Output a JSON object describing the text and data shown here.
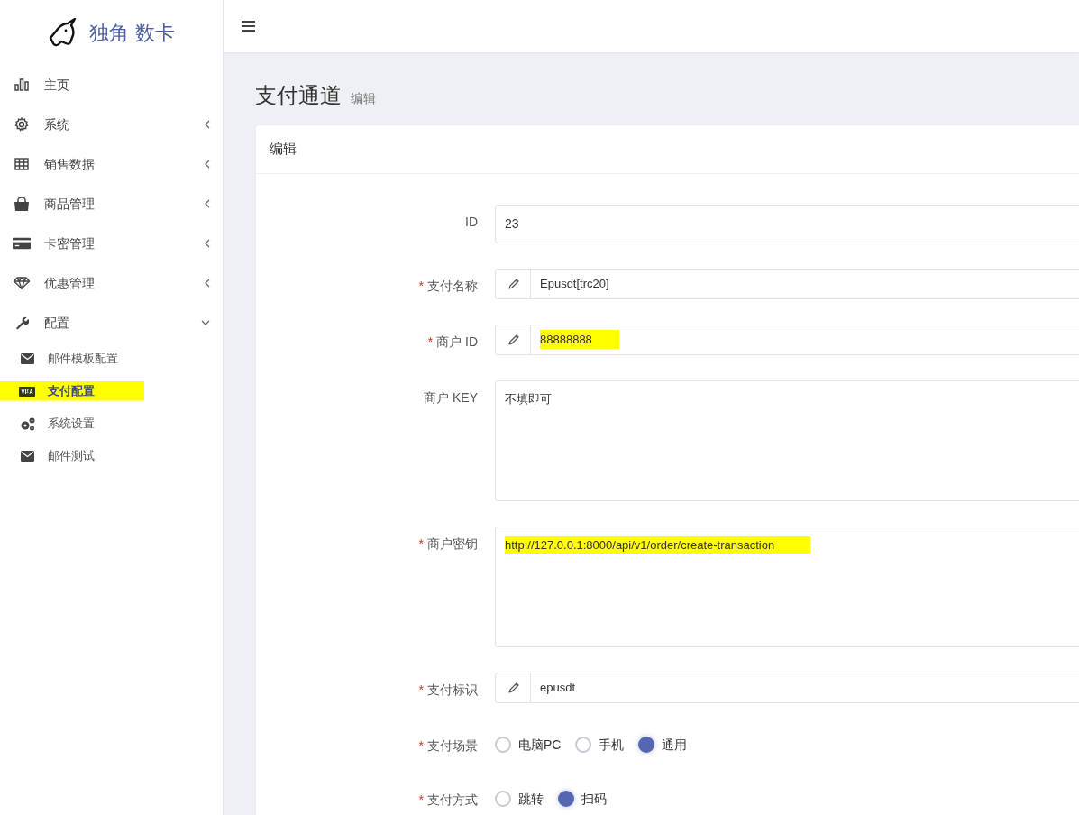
{
  "brand": {
    "name": "独角 数卡"
  },
  "sidebar": {
    "items": [
      {
        "label": "主页"
      },
      {
        "label": "系统",
        "expanded": false
      },
      {
        "label": "销售数据",
        "expanded": false
      },
      {
        "label": "商品管理",
        "expanded": false
      },
      {
        "label": "卡密管理",
        "expanded": false
      },
      {
        "label": "优惠管理",
        "expanded": false
      },
      {
        "label": "配置",
        "expanded": true,
        "children": [
          {
            "label": "邮件模板配置",
            "selected": false,
            "highlighted": false
          },
          {
            "label": "支付配置",
            "selected": true,
            "highlighted": true
          },
          {
            "label": "系统设置",
            "selected": false,
            "highlighted": false
          },
          {
            "label": "邮件测试",
            "selected": false,
            "highlighted": false
          }
        ]
      }
    ]
  },
  "page": {
    "title": "支付通道",
    "subtitle": "编辑"
  },
  "card": {
    "title": "编辑",
    "fields": [
      {
        "kind": "text",
        "label": "ID",
        "value": "23",
        "highlighted": false
      },
      {
        "kind": "icon-text",
        "label": "支付名称",
        "required_mark": "*",
        "value": "Epusdt[trc20]",
        "highlighted": false
      },
      {
        "kind": "icon-text",
        "label": "商户 ID",
        "required_mark": "*",
        "value": "88888888",
        "highlighted": true
      },
      {
        "kind": "textarea",
        "label": "商户 KEY",
        "value": "不填即可",
        "highlighted": false
      },
      {
        "kind": "textarea",
        "label": "商户密钥",
        "required_mark": "*",
        "value": "http://127.0.0.1:8000/api/v1/order/create-transaction",
        "highlighted": true
      },
      {
        "kind": "icon-text",
        "label": "支付标识",
        "required_mark": "*",
        "value": "epusdt",
        "highlighted": false
      },
      {
        "kind": "radio",
        "label": "支付场景",
        "required_mark": "*",
        "options": [
          {
            "label": "电脑PC",
            "selected": false
          },
          {
            "label": "手机",
            "selected": false
          },
          {
            "label": "通用",
            "selected": true
          }
        ]
      },
      {
        "kind": "radio",
        "label": "支付方式",
        "required_mark": "*",
        "options": [
          {
            "label": "跳转",
            "selected": false
          },
          {
            "label": "扫码",
            "selected": true
          }
        ]
      }
    ]
  }
}
